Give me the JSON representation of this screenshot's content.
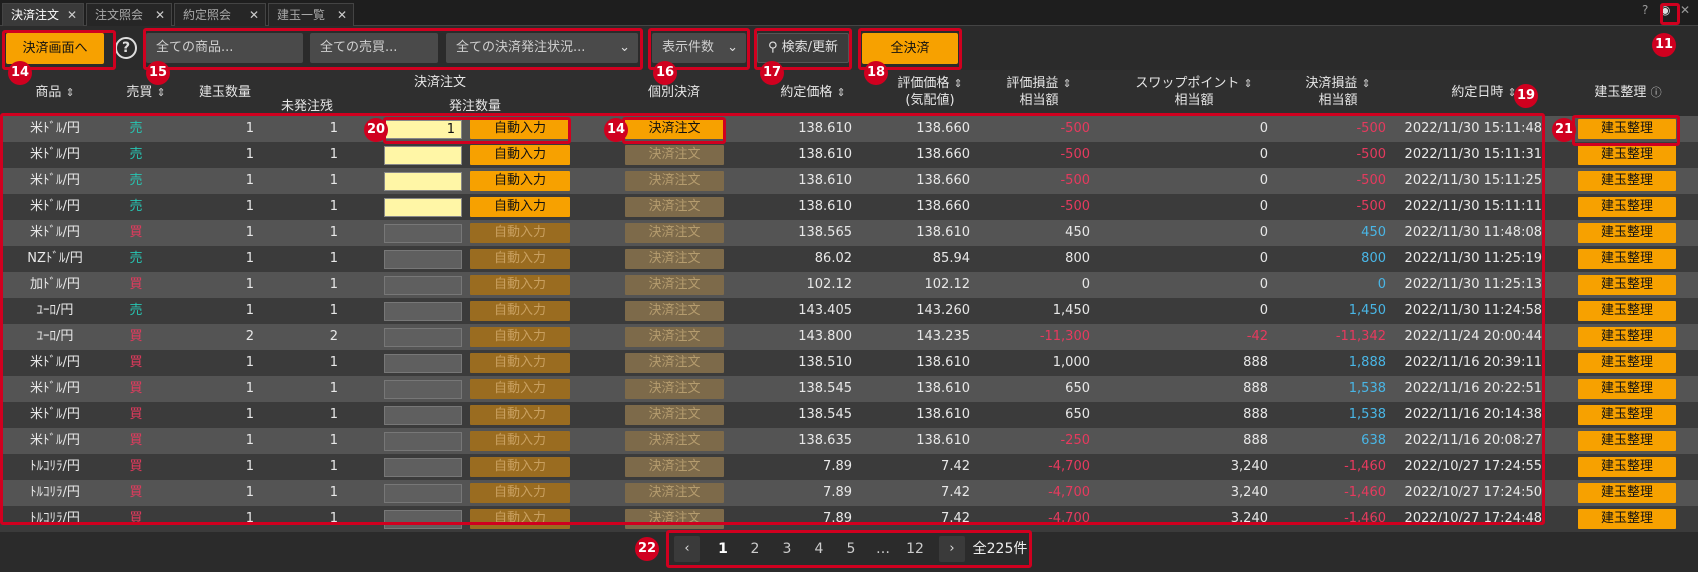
{
  "tabs": [
    {
      "label": "決済注文",
      "active": true
    },
    {
      "label": "注文照会",
      "active": false
    },
    {
      "label": "約定照会",
      "active": false
    },
    {
      "label": "建玉一覧",
      "active": false
    }
  ],
  "topright": {
    "help": "?",
    "eye": "◉",
    "close": "✕"
  },
  "toolbar": {
    "settle_screen_label": "決済画面へ",
    "help_label": "?",
    "product_filter": "全ての商品...",
    "side_filter": "全ての売買...",
    "status_filter": "全ての決済発注状況...",
    "display_count": "表示件数",
    "search_label": "検索/更新",
    "settle_all_label": "全決済"
  },
  "headers": {
    "product": "商品",
    "side": "売買",
    "position_qty": "建玉数量",
    "settle_order": "決済注文",
    "unfilled": "未発注残",
    "order_qty": "発注数量",
    "individual_settle": "個別決済",
    "exec_price": "約定価格",
    "eval_price_1": "評価価格",
    "eval_price_2": "(気配値)",
    "eval_pl_1": "評価損益",
    "eval_pl_2": "相当額",
    "swap_1": "スワップポイント",
    "swap_2": "相当額",
    "settle_pl_1": "決済損益",
    "settle_pl_2": "相当額",
    "exec_datetime": "約定日時",
    "position_org": "建玉整理"
  },
  "labels": {
    "auto_input": "自動入力",
    "settle_order": "決済注文",
    "position_org": "建玉整理"
  },
  "rows": [
    {
      "product": "米ﾄﾞﾙ/円",
      "side": "売",
      "side_type": "sell",
      "qty": "1",
      "unfilled": "1",
      "order_qty": "1",
      "enabled": true,
      "settle_enabled": true,
      "exec_price": "138.610",
      "eval_price": "138.660",
      "eval_pl": "-500",
      "eval_pl_type": "neg",
      "swap": "0",
      "swap_type": "",
      "settle_pl": "-500",
      "settle_pl_type": "neg",
      "datetime": "2022/11/30 15:11:48"
    },
    {
      "product": "米ﾄﾞﾙ/円",
      "side": "売",
      "side_type": "sell",
      "qty": "1",
      "unfilled": "1",
      "order_qty": "",
      "enabled": true,
      "settle_enabled": false,
      "exec_price": "138.610",
      "eval_price": "138.660",
      "eval_pl": "-500",
      "eval_pl_type": "neg",
      "swap": "0",
      "swap_type": "",
      "settle_pl": "-500",
      "settle_pl_type": "neg",
      "datetime": "2022/11/30 15:11:31"
    },
    {
      "product": "米ﾄﾞﾙ/円",
      "side": "売",
      "side_type": "sell",
      "qty": "1",
      "unfilled": "1",
      "order_qty": "",
      "enabled": true,
      "settle_enabled": false,
      "exec_price": "138.610",
      "eval_price": "138.660",
      "eval_pl": "-500",
      "eval_pl_type": "neg",
      "swap": "0",
      "swap_type": "",
      "settle_pl": "-500",
      "settle_pl_type": "neg",
      "datetime": "2022/11/30 15:11:25"
    },
    {
      "product": "米ﾄﾞﾙ/円",
      "side": "売",
      "side_type": "sell",
      "qty": "1",
      "unfilled": "1",
      "order_qty": "",
      "enabled": true,
      "settle_enabled": false,
      "exec_price": "138.610",
      "eval_price": "138.660",
      "eval_pl": "-500",
      "eval_pl_type": "neg",
      "swap": "0",
      "swap_type": "",
      "settle_pl": "-500",
      "settle_pl_type": "neg",
      "datetime": "2022/11/30 15:11:11"
    },
    {
      "product": "米ﾄﾞﾙ/円",
      "side": "買",
      "side_type": "buy",
      "qty": "1",
      "unfilled": "1",
      "order_qty": "",
      "enabled": false,
      "settle_enabled": false,
      "exec_price": "138.565",
      "eval_price": "138.610",
      "eval_pl": "450",
      "eval_pl_type": "",
      "swap": "0",
      "swap_type": "",
      "settle_pl": "450",
      "settle_pl_type": "pos",
      "datetime": "2022/11/30 11:48:08"
    },
    {
      "product": "NZﾄﾞﾙ/円",
      "side": "売",
      "side_type": "sell",
      "qty": "1",
      "unfilled": "1",
      "order_qty": "",
      "enabled": false,
      "settle_enabled": false,
      "exec_price": "86.02",
      "eval_price": "85.94",
      "eval_pl": "800",
      "eval_pl_type": "",
      "swap": "0",
      "swap_type": "",
      "settle_pl": "800",
      "settle_pl_type": "pos",
      "datetime": "2022/11/30 11:25:19"
    },
    {
      "product": "加ﾄﾞﾙ/円",
      "side": "買",
      "side_type": "buy",
      "qty": "1",
      "unfilled": "1",
      "order_qty": "",
      "enabled": false,
      "settle_enabled": false,
      "exec_price": "102.12",
      "eval_price": "102.12",
      "eval_pl": "0",
      "eval_pl_type": "",
      "swap": "0",
      "swap_type": "",
      "settle_pl": "0",
      "settle_pl_type": "pos",
      "datetime": "2022/11/30 11:25:13"
    },
    {
      "product": "ﾕｰﾛ/円",
      "side": "売",
      "side_type": "sell",
      "qty": "1",
      "unfilled": "1",
      "order_qty": "",
      "enabled": false,
      "settle_enabled": false,
      "exec_price": "143.405",
      "eval_price": "143.260",
      "eval_pl": "1,450",
      "eval_pl_type": "",
      "swap": "0",
      "swap_type": "",
      "settle_pl": "1,450",
      "settle_pl_type": "pos",
      "datetime": "2022/11/30 11:24:58"
    },
    {
      "product": "ﾕｰﾛ/円",
      "side": "買",
      "side_type": "buy",
      "qty": "2",
      "unfilled": "2",
      "order_qty": "",
      "enabled": false,
      "settle_enabled": false,
      "exec_price": "143.800",
      "eval_price": "143.235",
      "eval_pl": "-11,300",
      "eval_pl_type": "neg",
      "swap": "-42",
      "swap_type": "neg",
      "settle_pl": "-11,342",
      "settle_pl_type": "neg",
      "datetime": "2022/11/24 20:00:44"
    },
    {
      "product": "米ﾄﾞﾙ/円",
      "side": "買",
      "side_type": "buy",
      "qty": "1",
      "unfilled": "1",
      "order_qty": "",
      "enabled": false,
      "settle_enabled": false,
      "exec_price": "138.510",
      "eval_price": "138.610",
      "eval_pl": "1,000",
      "eval_pl_type": "",
      "swap": "888",
      "swap_type": "",
      "settle_pl": "1,888",
      "settle_pl_type": "pos",
      "datetime": "2022/11/16 20:39:11"
    },
    {
      "product": "米ﾄﾞﾙ/円",
      "side": "買",
      "side_type": "buy",
      "qty": "1",
      "unfilled": "1",
      "order_qty": "",
      "enabled": false,
      "settle_enabled": false,
      "exec_price": "138.545",
      "eval_price": "138.610",
      "eval_pl": "650",
      "eval_pl_type": "",
      "swap": "888",
      "swap_type": "",
      "settle_pl": "1,538",
      "settle_pl_type": "pos",
      "datetime": "2022/11/16 20:22:51"
    },
    {
      "product": "米ﾄﾞﾙ/円",
      "side": "買",
      "side_type": "buy",
      "qty": "1",
      "unfilled": "1",
      "order_qty": "",
      "enabled": false,
      "settle_enabled": false,
      "exec_price": "138.545",
      "eval_price": "138.610",
      "eval_pl": "650",
      "eval_pl_type": "",
      "swap": "888",
      "swap_type": "",
      "settle_pl": "1,538",
      "settle_pl_type": "pos",
      "datetime": "2022/11/16 20:14:38"
    },
    {
      "product": "米ﾄﾞﾙ/円",
      "side": "買",
      "side_type": "buy",
      "qty": "1",
      "unfilled": "1",
      "order_qty": "",
      "enabled": false,
      "settle_enabled": false,
      "exec_price": "138.635",
      "eval_price": "138.610",
      "eval_pl": "-250",
      "eval_pl_type": "neg",
      "swap": "888",
      "swap_type": "",
      "settle_pl": "638",
      "settle_pl_type": "pos",
      "datetime": "2022/11/16 20:08:27"
    },
    {
      "product": "ﾄﾙｺﾘﾗ/円",
      "side": "買",
      "side_type": "buy",
      "qty": "1",
      "unfilled": "1",
      "order_qty": "",
      "enabled": false,
      "settle_enabled": false,
      "exec_price": "7.89",
      "eval_price": "7.42",
      "eval_pl": "-4,700",
      "eval_pl_type": "neg",
      "swap": "3,240",
      "swap_type": "",
      "settle_pl": "-1,460",
      "settle_pl_type": "neg",
      "datetime": "2022/10/27 17:24:55"
    },
    {
      "product": "ﾄﾙｺﾘﾗ/円",
      "side": "買",
      "side_type": "buy",
      "qty": "1",
      "unfilled": "1",
      "order_qty": "",
      "enabled": false,
      "settle_enabled": false,
      "exec_price": "7.89",
      "eval_price": "7.42",
      "eval_pl": "-4,700",
      "eval_pl_type": "neg",
      "swap": "3,240",
      "swap_type": "",
      "settle_pl": "-1,460",
      "settle_pl_type": "neg",
      "datetime": "2022/10/27 17:24:50"
    },
    {
      "product": "ﾄﾙｺﾘﾗ/円",
      "side": "買",
      "side_type": "buy",
      "qty": "1",
      "unfilled": "1",
      "order_qty": "",
      "enabled": false,
      "settle_enabled": false,
      "exec_price": "7.89",
      "eval_price": "7.42",
      "eval_pl": "-4,700",
      "eval_pl_type": "neg",
      "swap": "3,240",
      "swap_type": "",
      "settle_pl": "-1,460",
      "settle_pl_type": "neg",
      "datetime": "2022/10/27 17:24:48"
    }
  ],
  "pagination": {
    "prev": "‹",
    "pages": [
      "1",
      "2",
      "3",
      "4",
      "5",
      "…",
      "12"
    ],
    "current": "1",
    "next": "›",
    "total": "全225件"
  },
  "annotations": {
    "b11": "11",
    "b14a": "14",
    "b15": "15",
    "b16": "16",
    "b17": "17",
    "b18": "18",
    "b19": "19",
    "b20": "20",
    "b14b": "14",
    "b21": "21",
    "b22": "22"
  },
  "colors": {
    "accent": "#f7a100",
    "sell": "#27c6b3",
    "buy": "#e63a5e",
    "positive": "#49b6e6",
    "highlight": "#d0001f"
  }
}
